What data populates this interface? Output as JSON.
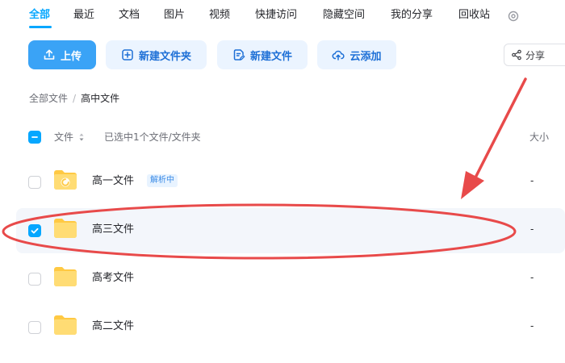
{
  "tabs": [
    {
      "label": "全部",
      "active": true
    },
    {
      "label": "最近"
    },
    {
      "label": "文档"
    },
    {
      "label": "图片"
    },
    {
      "label": "视频"
    },
    {
      "label": "快捷访问"
    },
    {
      "label": "隐藏空间"
    },
    {
      "label": "我的分享"
    },
    {
      "label": "回收站"
    }
  ],
  "toolbar": {
    "upload": "上传",
    "new_folder": "新建文件夹",
    "new_file": "新建文件",
    "cloud_add": "云添加",
    "share": "分享"
  },
  "breadcrumb": {
    "root": "全部文件",
    "separator": "/",
    "current": "高中文件"
  },
  "list_header": {
    "name_col": "文件",
    "selection_status": "已选中1个文件/文件夹",
    "size_col": "大小"
  },
  "files": [
    {
      "name": "高一文件",
      "badge": "解析中",
      "size": "-",
      "checked": false
    },
    {
      "name": "高三文件",
      "size": "-",
      "checked": true
    },
    {
      "name": "高考文件",
      "size": "-",
      "checked": false
    },
    {
      "name": "高二文件",
      "size": "-",
      "checked": false
    }
  ],
  "icons": {
    "settings": "gear-icon",
    "upload": "upload-icon",
    "new_folder": "folder-plus-icon",
    "new_file": "file-edit-icon",
    "cloud_add": "cloud-upload-icon",
    "share": "share-icon",
    "folder": "folder-icon",
    "check": "check-icon"
  },
  "colors": {
    "accent": "#06a7ff",
    "primary_button": "#3aa3f6",
    "secondary_button_bg": "#ebf4ff",
    "selected_row_bg": "#f3f6fb",
    "annotation_red": "#e84a4a",
    "folder_yellow": "#ffcf55"
  }
}
